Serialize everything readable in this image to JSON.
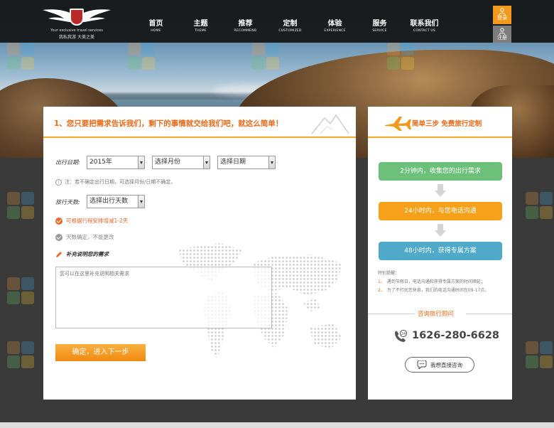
{
  "header": {
    "logo": {
      "tagline_en": "Your exclusive travel services",
      "tagline_cn": "我私我游 大美之美"
    },
    "nav": [
      {
        "cn": "首页",
        "en": "HOME"
      },
      {
        "cn": "主题",
        "en": "THEME"
      },
      {
        "cn": "推荐",
        "en": "RECOMMEND"
      },
      {
        "cn": "定制",
        "en": "CUSTOMIZED"
      },
      {
        "cn": "体验",
        "en": "EXPERIENCE"
      },
      {
        "cn": "服务",
        "en": "SERVICE"
      },
      {
        "cn": "联系我们",
        "en": "CONTACT US"
      }
    ],
    "login_label": "登录",
    "register_label": "注册"
  },
  "form": {
    "title": "1、您只要把需求告诉我们，剩下的事情就交给我们吧，就这么简单！",
    "date_label": "出行日期:",
    "year_value": "2015年",
    "month_value": "选择月份",
    "day_value": "选择日期",
    "date_note": "注：若不确定出行日期，可选择月份/日期不确定。",
    "days_label": "旅行天数:",
    "days_value": "选择出行天数",
    "option_flexible": "可根据行程安排增减1-2天",
    "option_fixed": "天数确定，不能更改",
    "extra_label": "补充说明您的需求",
    "textarea_placeholder": "您可以在这里补充说明相关需求",
    "submit_label": "确定，进入下一步"
  },
  "side": {
    "title": "简单三步 免费旅行定制",
    "steps": [
      {
        "text": "2分钟内，收集您的出行需求",
        "color": "#6cc07a"
      },
      {
        "text": "24小时内，与您电话沟通",
        "color": "#f7a11a"
      },
      {
        "text": "48小时内，获得专属方案",
        "color": "#4fa9c8"
      }
    ],
    "tips_title": "特别提醒：",
    "tips": [
      {
        "num": "1、",
        "text": "遇到节假日，电话沟通和获得专属方案的时间顺延；"
      },
      {
        "num": "2、",
        "text": "为了不打扰您休息，我们的电话沟通时间在09-17点。"
      }
    ],
    "consult_title": "咨询旅行顾问",
    "phone_badge": "24",
    "phone": "1626-280-6628",
    "consult_button": "我想直接咨询"
  },
  "colors": {
    "accent_orange": "#f39a1e",
    "title_orange": "#e96a1a",
    "check_orange": "#e8692a",
    "check_gray": "#999999"
  }
}
